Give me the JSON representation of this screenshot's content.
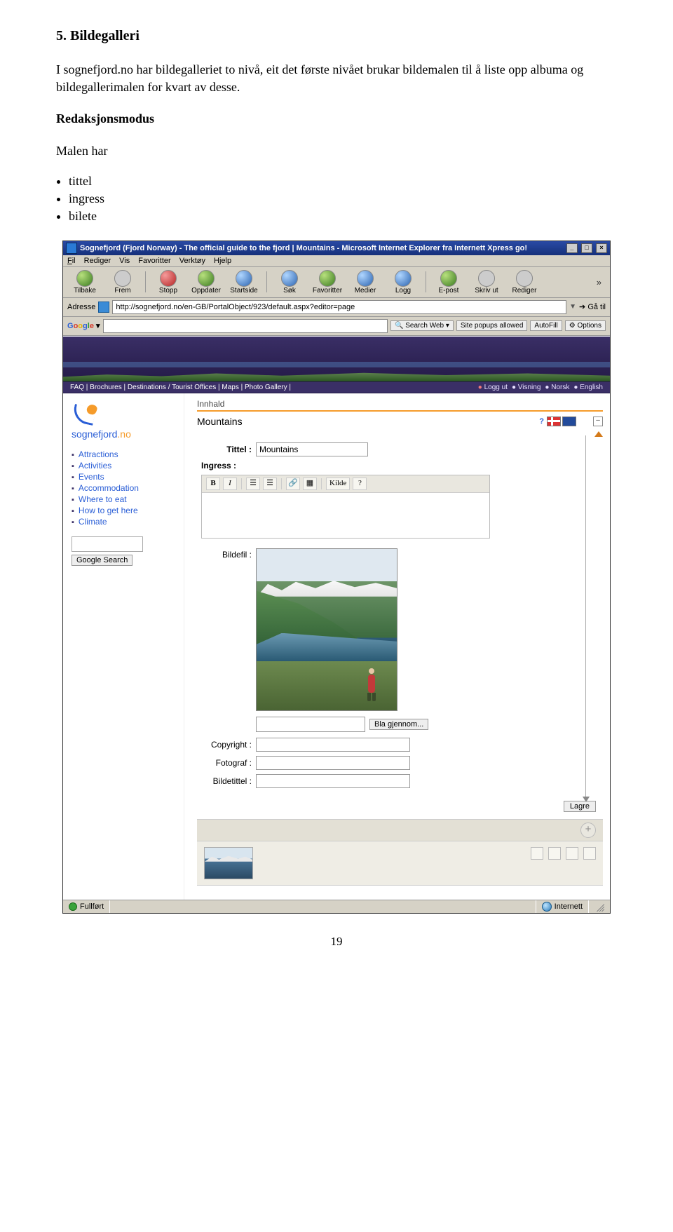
{
  "heading": "5. Bildegalleri",
  "p1": "I sognefjord.no har bildegalleriet to nivå, eit det første nivået brukar bildemalen til å liste opp albuma og bildegallerimalen for kvart av desse.",
  "redaksjonsmodus_heading": "Redaksjonsmodus",
  "malen_har": "Malen har",
  "bullets": [
    "tittel",
    "ingress",
    "bilete"
  ],
  "page_number": "19",
  "ie": {
    "title": "Sognefjord (Fjord Norway) - The official guide to the fjord | Mountains - Microsoft Internet Explorer fra Internett Xpress go!",
    "menu": {
      "fil": "Fil",
      "rediger": "Rediger",
      "vis": "Vis",
      "favoritter": "Favoritter",
      "verktoy": "Verktøy",
      "hjelp": "Hjelp"
    },
    "toolbar": {
      "tilbake": "Tilbake",
      "frem": "Frem",
      "stopp": "Stopp",
      "oppdater": "Oppdater",
      "startside": "Startside",
      "sok": "Søk",
      "favoritter": "Favoritter",
      "medier": "Medier",
      "logg": "Logg",
      "epost": "E-post",
      "skrivut": "Skriv ut",
      "rediger": "Rediger"
    },
    "addr_label": "Adresse",
    "addr_value": "http://sognefjord.no/en-GB/PortalObject/923/default.aspx?editor=page",
    "go": "Gå til",
    "google": {
      "search_web": "Search Web",
      "popups": "Site popups allowed",
      "autofill": "AutoFill",
      "options": "Options"
    }
  },
  "nav": {
    "left": "FAQ | Brochures | Destinations / Tourist Offices | Maps | Photo Gallery |",
    "logout": "Logg ut",
    "visning": "Visning",
    "norsk": "Norsk",
    "english": "English"
  },
  "logo_text": {
    "sogne": "sogne",
    "fjord": "fjord",
    "dot": ".no"
  },
  "leftnav": [
    "Attractions",
    "Activities",
    "Events",
    "Accommodation",
    "Where to eat",
    "How to get here",
    "Climate"
  ],
  "google_search_btn": "Google Search",
  "tab": "Innhald",
  "section_title": "Mountains",
  "help_icon": "?",
  "lang_no": "NO",
  "lang_en": "EN",
  "form": {
    "tittel_label": "Tittel :",
    "tittel_value": "Mountains",
    "ingress_label": "Ingress :",
    "kilde": "Kilde",
    "bildefil_label": "Bildefil :",
    "browse": "Bla gjennom...",
    "copyright": "Copyright :",
    "fotograf": "Fotograf :",
    "bildetittel": "Bildetittel :",
    "lagre": "Lagre"
  },
  "status": {
    "fullfort": "Fullført",
    "internett": "Internett"
  }
}
